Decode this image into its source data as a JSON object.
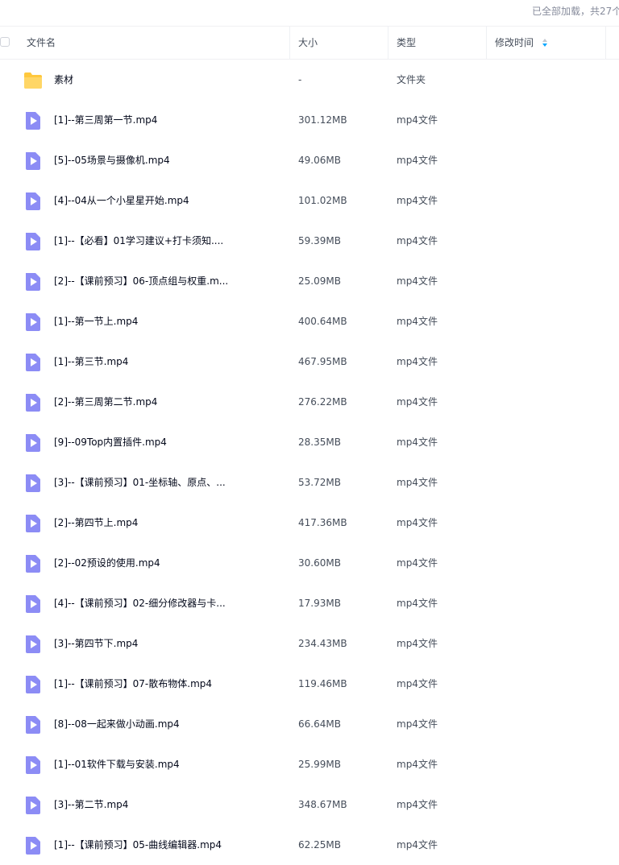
{
  "status": {
    "loaded_text": "已全部加载，共27个"
  },
  "header": {
    "name_label": "文件名",
    "size_label": "大小",
    "type_label": "类型",
    "modified_label": "修改时间"
  },
  "colors": {
    "folder": "#ffc83d",
    "video_icon": "#8c8cf5",
    "sort_active": "#06a7ff"
  },
  "rows": [
    {
      "icon": "folder-icon",
      "name": "素材",
      "size": "-",
      "type": "文件夹"
    },
    {
      "icon": "video-file-icon",
      "name": "[1]--第三周第一节.mp4",
      "size": "301.12MB",
      "type": "mp4文件"
    },
    {
      "icon": "video-file-icon",
      "name": "[5]--05场景与摄像机.mp4",
      "size": "49.06MB",
      "type": "mp4文件"
    },
    {
      "icon": "video-file-icon",
      "name": "[4]--04从一个小星星开始.mp4",
      "size": "101.02MB",
      "type": "mp4文件"
    },
    {
      "icon": "video-file-icon",
      "name": "[1]--【必看】01学习建议+打卡须知....",
      "size": "59.39MB",
      "type": "mp4文件"
    },
    {
      "icon": "video-file-icon",
      "name": "[2]--【课前预习】06-顶点组与权重.m...",
      "size": "25.09MB",
      "type": "mp4文件"
    },
    {
      "icon": "video-file-icon",
      "name": "[1]--第一节上.mp4",
      "size": "400.64MB",
      "type": "mp4文件"
    },
    {
      "icon": "video-file-icon",
      "name": "[1]--第三节.mp4",
      "size": "467.95MB",
      "type": "mp4文件"
    },
    {
      "icon": "video-file-icon",
      "name": "[2]--第三周第二节.mp4",
      "size": "276.22MB",
      "type": "mp4文件"
    },
    {
      "icon": "video-file-icon",
      "name": "[9]--09Top内置插件.mp4",
      "size": "28.35MB",
      "type": "mp4文件"
    },
    {
      "icon": "video-file-icon",
      "name": "[3]--【课前预习】01-坐标轴、原点、...",
      "size": "53.72MB",
      "type": "mp4文件"
    },
    {
      "icon": "video-file-icon",
      "name": "[2]--第四节上.mp4",
      "size": "417.36MB",
      "type": "mp4文件"
    },
    {
      "icon": "video-file-icon",
      "name": "[2]--02预设的使用.mp4",
      "size": "30.60MB",
      "type": "mp4文件"
    },
    {
      "icon": "video-file-icon",
      "name": "[4]--【课前预习】02-细分修改器与卡...",
      "size": "17.93MB",
      "type": "mp4文件"
    },
    {
      "icon": "video-file-icon",
      "name": "[3]--第四节下.mp4",
      "size": "234.43MB",
      "type": "mp4文件"
    },
    {
      "icon": "video-file-icon",
      "name": "[1]--【课前预习】07-散布物体.mp4",
      "size": "119.46MB",
      "type": "mp4文件"
    },
    {
      "icon": "video-file-icon",
      "name": "[8]--08一起来做小动画.mp4",
      "size": "66.64MB",
      "type": "mp4文件"
    },
    {
      "icon": "video-file-icon",
      "name": "[1]--01软件下载与安装.mp4",
      "size": "25.99MB",
      "type": "mp4文件"
    },
    {
      "icon": "video-file-icon",
      "name": "[3]--第二节.mp4",
      "size": "348.67MB",
      "type": "mp4文件"
    },
    {
      "icon": "video-file-icon",
      "name": "[1]--【课前预习】05-曲线编辑器.mp4",
      "size": "62.25MB",
      "type": "mp4文件"
    }
  ]
}
